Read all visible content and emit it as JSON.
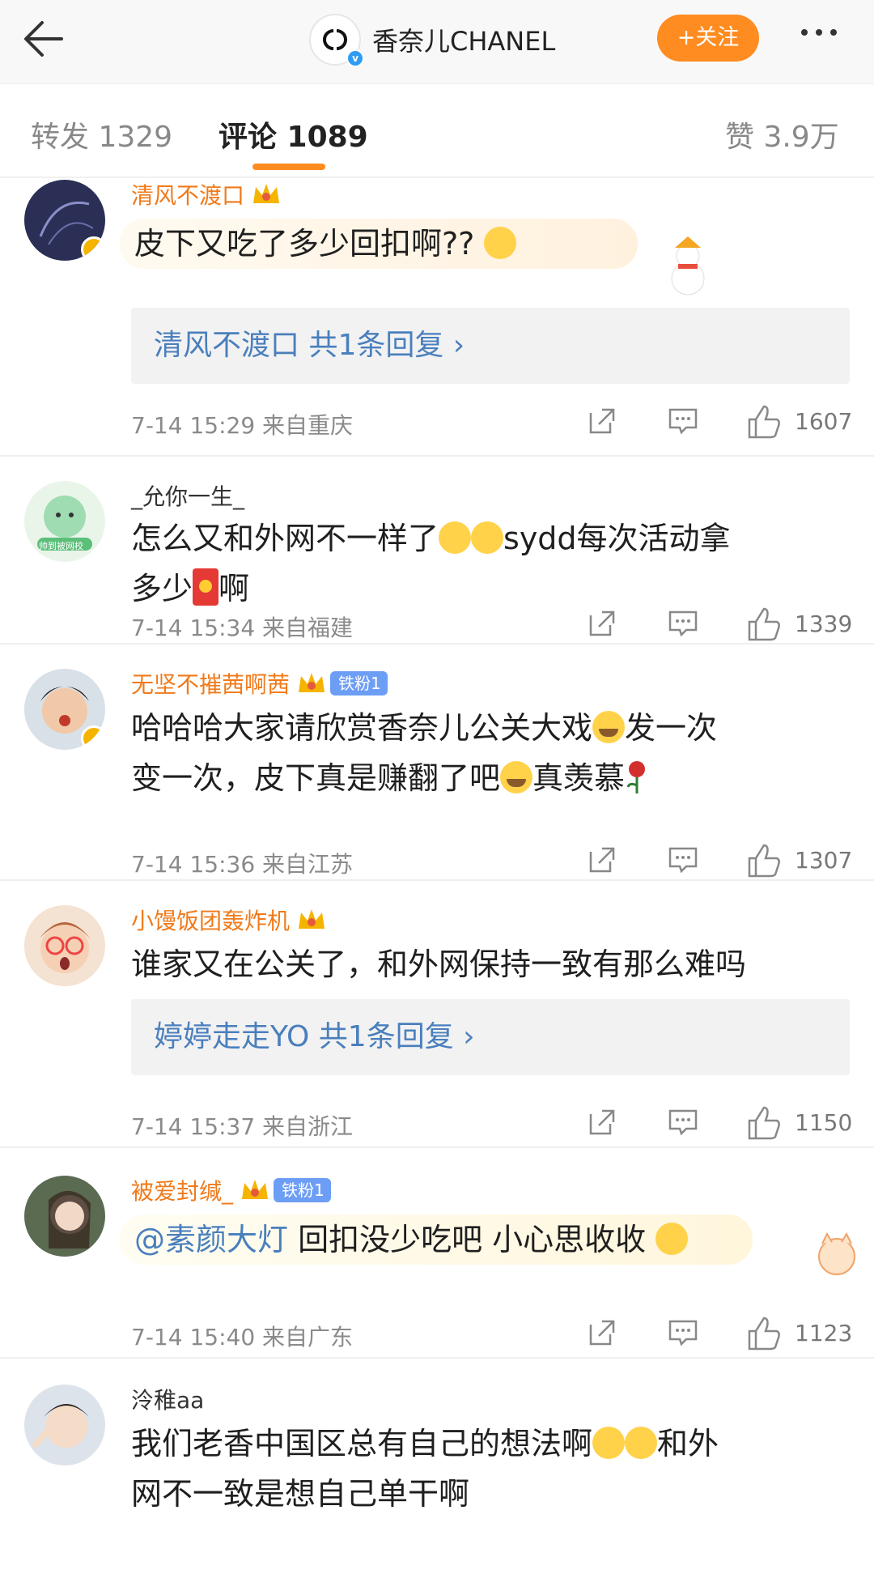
{
  "header": {
    "brand_name": "香奈儿CHANEL",
    "follow_label": "+关注"
  },
  "tabs": {
    "repost": "转发 1329",
    "comments": "评论 1089",
    "likes": "赞 3.9万"
  },
  "comments": [
    {
      "user": "清风不渡口",
      "text": "皮下又吃了多少回扣啊??",
      "reply": "清风不渡口  共1条回复 ›",
      "time": "7-14 15:29  来自重庆",
      "likes": "1607"
    },
    {
      "user": "_允你一生_",
      "avatar_caption": "帅到被网校",
      "text_line1a": "怎么又和外网不一样了",
      "text_line1b": "sydd每次活动拿",
      "text_line2a": "多少",
      "text_line2b": "啊",
      "time": "7-14 15:34  来自福建",
      "likes": "1339"
    },
    {
      "user": "无坚不摧茜啊茜",
      "badge": "铁粉1",
      "text_line1a": "哈哈哈大家请欣赏香奈儿公关大戏",
      "text_line1b": "发一次",
      "text_line2a": "变一次，皮下真是赚翻了吧",
      "text_line2b": "真羡慕",
      "time": "7-14 15:36  来自江苏",
      "likes": "1307"
    },
    {
      "user": "小馒饭团轰炸机",
      "text": "谁家又在公关了，和外网保持一致有那么难吗",
      "reply": "婷婷走走YO  共1条回复 ›",
      "time": "7-14 15:37  来自浙江",
      "likes": "1150"
    },
    {
      "user": "被爱封缄_",
      "badge": "铁粉1",
      "mention": "@素颜大灯",
      "text": " 回扣没少吃吧 小心思收收 ",
      "time": "7-14 15:40  来自广东",
      "likes": "1123"
    },
    {
      "user": "泠稚aa",
      "text_line1a": "我们老香中国区总有自己的想法啊",
      "text_line1b": "和外",
      "text_line2a": "网不一致是想自己单干啊"
    }
  ],
  "colors": {
    "accent": "#ff8c21",
    "username": "#f07a1a",
    "link": "#4a7fbd",
    "verified": "#2f9cf5"
  }
}
